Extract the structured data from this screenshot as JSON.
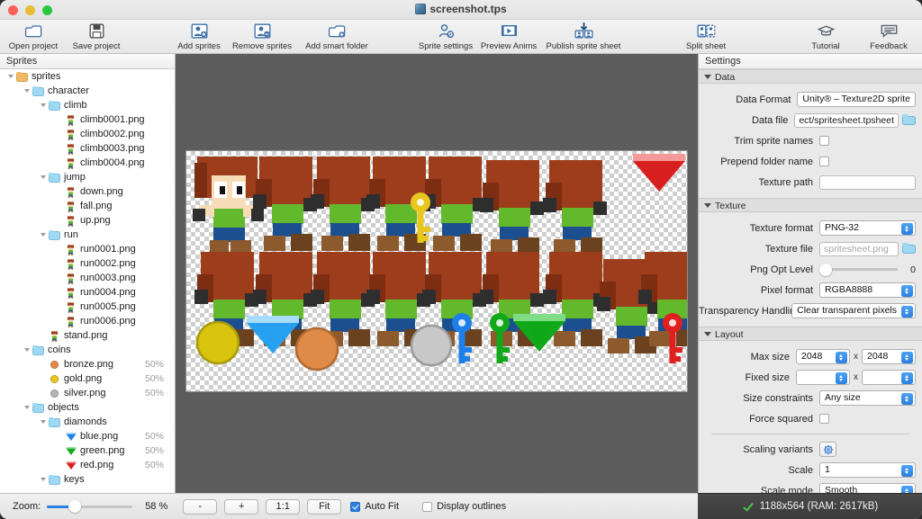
{
  "window": {
    "title": "screenshot.tps",
    "icon": "tps-file-icon"
  },
  "toolbar": {
    "left": [
      {
        "label": "Open project",
        "icon": "open-folder-icon"
      },
      {
        "label": "Save project",
        "icon": "floppy-disk-icon"
      }
    ],
    "middle": [
      {
        "label": "Add sprites",
        "icon": "add-sprite-icon"
      },
      {
        "label": "Remove sprites",
        "icon": "remove-sprite-icon"
      },
      {
        "label": "Add smart folder",
        "icon": "smart-folder-icon"
      }
    ],
    "center": [
      {
        "label": "Sprite settings",
        "icon": "sprite-settings-icon"
      },
      {
        "label": "Preview Anims",
        "icon": "play-film-icon"
      },
      {
        "label": "Publish sprite sheet",
        "icon": "publish-download-icon"
      }
    ],
    "split": [
      {
        "label": "Split sheet",
        "icon": "split-sheet-icon"
      }
    ],
    "right": [
      {
        "label": "Tutorial",
        "icon": "graduation-cap-icon"
      },
      {
        "label": "Feedback",
        "icon": "speech-bubble-icon"
      }
    ]
  },
  "sidebar": {
    "header": "Sprites",
    "tree": [
      {
        "label": "sprites",
        "depth": 0,
        "type": "folder-orange",
        "expanded": true,
        "pct": ""
      },
      {
        "label": "character",
        "depth": 1,
        "type": "folder-blue",
        "expanded": true,
        "pct": ""
      },
      {
        "label": "climb",
        "depth": 2,
        "type": "folder-blue",
        "expanded": true,
        "pct": ""
      },
      {
        "label": "climb0001.png",
        "depth": 3,
        "type": "sprite-char",
        "expanded": null,
        "pct": ""
      },
      {
        "label": "climb0002.png",
        "depth": 3,
        "type": "sprite-char",
        "expanded": null,
        "pct": ""
      },
      {
        "label": "climb0003.png",
        "depth": 3,
        "type": "sprite-char",
        "expanded": null,
        "pct": ""
      },
      {
        "label": "climb0004.png",
        "depth": 3,
        "type": "sprite-char",
        "expanded": null,
        "pct": ""
      },
      {
        "label": "jump",
        "depth": 2,
        "type": "folder-blue",
        "expanded": true,
        "pct": ""
      },
      {
        "label": "down.png",
        "depth": 3,
        "type": "sprite-char",
        "expanded": null,
        "pct": ""
      },
      {
        "label": "fall.png",
        "depth": 3,
        "type": "sprite-char",
        "expanded": null,
        "pct": ""
      },
      {
        "label": "up.png",
        "depth": 3,
        "type": "sprite-char",
        "expanded": null,
        "pct": ""
      },
      {
        "label": "run",
        "depth": 2,
        "type": "folder-blue",
        "expanded": true,
        "pct": ""
      },
      {
        "label": "run0001.png",
        "depth": 3,
        "type": "sprite-char",
        "expanded": null,
        "pct": ""
      },
      {
        "label": "run0002.png",
        "depth": 3,
        "type": "sprite-char",
        "expanded": null,
        "pct": ""
      },
      {
        "label": "run0003.png",
        "depth": 3,
        "type": "sprite-char",
        "expanded": null,
        "pct": ""
      },
      {
        "label": "run0004.png",
        "depth": 3,
        "type": "sprite-char",
        "expanded": null,
        "pct": ""
      },
      {
        "label": "run0005.png",
        "depth": 3,
        "type": "sprite-char",
        "expanded": null,
        "pct": ""
      },
      {
        "label": "run0006.png",
        "depth": 3,
        "type": "sprite-char",
        "expanded": null,
        "pct": ""
      },
      {
        "label": "stand.png",
        "depth": 2,
        "type": "sprite-char",
        "expanded": null,
        "pct": ""
      },
      {
        "label": "coins",
        "depth": 1,
        "type": "folder-blue",
        "expanded": true,
        "pct": ""
      },
      {
        "label": "bronze.png",
        "depth": 2,
        "type": "coin-bronze",
        "expanded": null,
        "pct": "50%"
      },
      {
        "label": "gold.png",
        "depth": 2,
        "type": "coin-gold",
        "expanded": null,
        "pct": "50%"
      },
      {
        "label": "silver.png",
        "depth": 2,
        "type": "coin-silver",
        "expanded": null,
        "pct": "50%"
      },
      {
        "label": "objects",
        "depth": 1,
        "type": "folder-blue",
        "expanded": true,
        "pct": ""
      },
      {
        "label": "diamonds",
        "depth": 2,
        "type": "folder-blue",
        "expanded": true,
        "pct": ""
      },
      {
        "label": "blue.png",
        "depth": 3,
        "type": "gem-blue",
        "expanded": null,
        "pct": "50%"
      },
      {
        "label": "green.png",
        "depth": 3,
        "type": "gem-green",
        "expanded": null,
        "pct": "50%"
      },
      {
        "label": "red.png",
        "depth": 3,
        "type": "gem-red",
        "expanded": null,
        "pct": "50%"
      },
      {
        "label": "keys",
        "depth": 2,
        "type": "folder-blue",
        "expanded": true,
        "pct": ""
      }
    ]
  },
  "settings": {
    "header": "Settings",
    "sections": [
      {
        "title": "Data",
        "rows": [
          {
            "label": "Data Format",
            "kind": "combo",
            "value": "Unity® – Texture2D sprite"
          },
          {
            "label": "Data file",
            "kind": "path",
            "value": "ect/spritesheet.tpsheet"
          },
          {
            "label": "Trim sprite names",
            "kind": "checkbox",
            "value": false
          },
          {
            "label": "Prepend folder name",
            "kind": "checkbox",
            "value": false
          },
          {
            "label": "Texture path",
            "kind": "text",
            "value": "",
            "placeholder": ""
          }
        ]
      },
      {
        "title": "Texture",
        "rows": [
          {
            "label": "Texture format",
            "kind": "combo",
            "value": "PNG-32"
          },
          {
            "label": "Texture file",
            "kind": "path",
            "value": "",
            "placeholder": "spritesheet.png"
          },
          {
            "label": "Png Opt Level",
            "kind": "slider",
            "value": "0"
          },
          {
            "label": "Pixel format",
            "kind": "combo",
            "value": "RGBA8888"
          },
          {
            "label": "Transparency Handling",
            "kind": "combo",
            "value": "Clear transparent pixels"
          }
        ]
      },
      {
        "title": "Layout",
        "rows": [
          {
            "label": "Max size",
            "kind": "combo-pair",
            "value": "2048",
            "value2": "2048",
            "sep": "x"
          },
          {
            "label": "Fixed size",
            "kind": "combo-pair",
            "value": "",
            "value2": "",
            "sep": "x"
          },
          {
            "label": "Size constraints",
            "kind": "combo",
            "value": "Any size"
          },
          {
            "label": "Force squared",
            "kind": "checkbox",
            "value": false
          },
          {
            "label": "Scaling variants",
            "kind": "gear",
            "value": ""
          },
          {
            "label": "Scale",
            "kind": "combo",
            "value": "1"
          },
          {
            "label": "Scale mode",
            "kind": "combo",
            "value": "Smooth"
          }
        ]
      }
    ]
  },
  "bottombar": {
    "zoom_label": "Zoom:",
    "zoom_value": "58 %",
    "minus": "-",
    "plus": "+",
    "one_to_one": "1:1",
    "fit": "Fit",
    "auto_fit": "Auto Fit",
    "auto_fit_checked": true,
    "display_outlines": "Display outlines",
    "display_outlines_checked": false,
    "status": "1188x564 (RAM: 2617kB)"
  },
  "colors": {
    "accent": "#2b7fe0",
    "folder_root": "#f0b963",
    "folder_sub": "#9fd8f3",
    "ok_green": "#49c24a"
  }
}
